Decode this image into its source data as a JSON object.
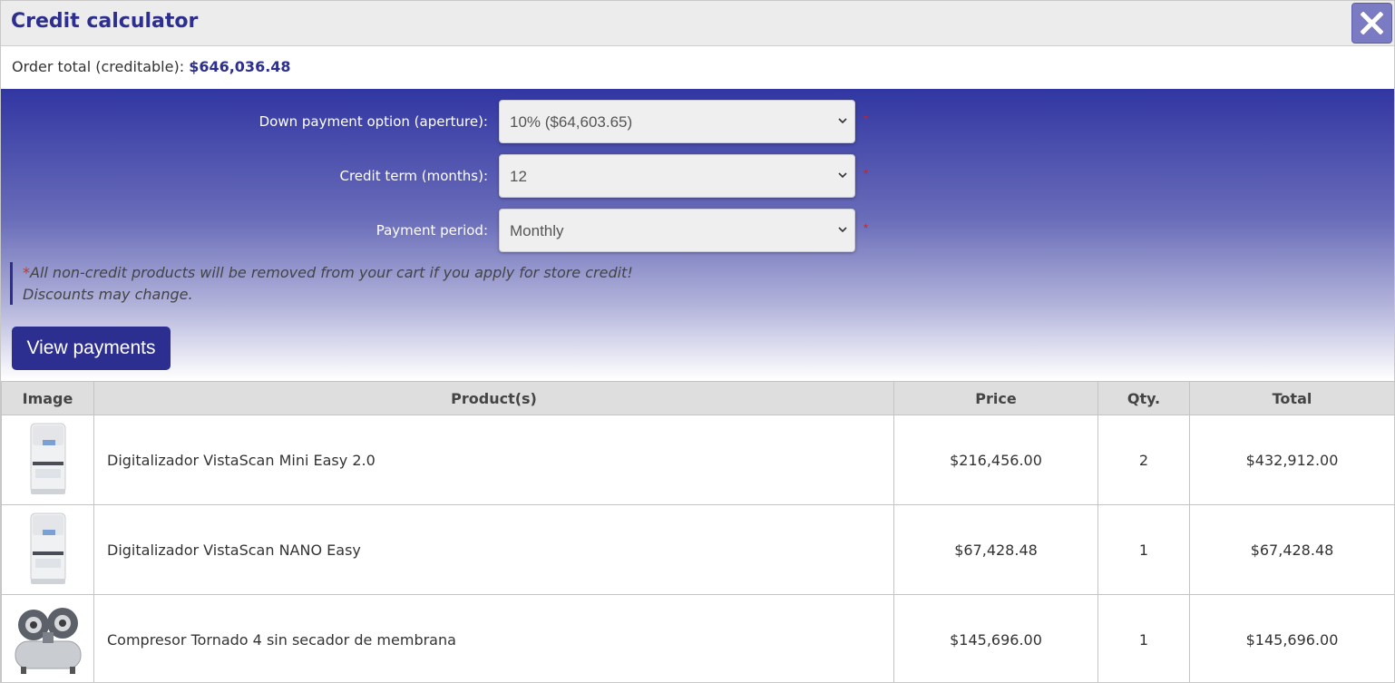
{
  "dialog": {
    "title": "Credit calculator",
    "close_icon": "close-icon"
  },
  "order": {
    "label": "Order total (creditable):",
    "amount": "$646,036.48"
  },
  "form": {
    "down_payment": {
      "label": "Down payment option (aperture):",
      "value": "10% ($64,603.65)"
    },
    "credit_term": {
      "label": "Credit term (months):",
      "value": "12"
    },
    "payment_period": {
      "label": "Payment period:",
      "value": "Monthly"
    },
    "required_mark": "*"
  },
  "notice": {
    "star": "*",
    "line1": "All non-credit products will be removed from your cart if you apply for store credit!",
    "line2": "Discounts may change."
  },
  "actions": {
    "view_payments": "View payments"
  },
  "table": {
    "headers": [
      "Image",
      "Product(s)",
      "Price",
      "Qty.",
      "Total"
    ],
    "rows": [
      {
        "image_icon": "scanner-image",
        "product": "Digitalizador VistaScan Mini Easy 2.0",
        "price": "$216,456.00",
        "qty": "2",
        "total": "$432,912.00"
      },
      {
        "image_icon": "scanner-image",
        "product": "Digitalizador VistaScan NANO Easy",
        "price": "$67,428.48",
        "qty": "1",
        "total": "$67,428.48"
      },
      {
        "image_icon": "compressor-image",
        "product": "Compresor Tornado 4 sin secador de membrana",
        "price": "$145,696.00",
        "qty": "1",
        "total": "$145,696.00"
      }
    ]
  },
  "colors": {
    "brand": "#2c2f8f",
    "accent_close": "#7a7bc2",
    "required": "#d21f1f"
  }
}
